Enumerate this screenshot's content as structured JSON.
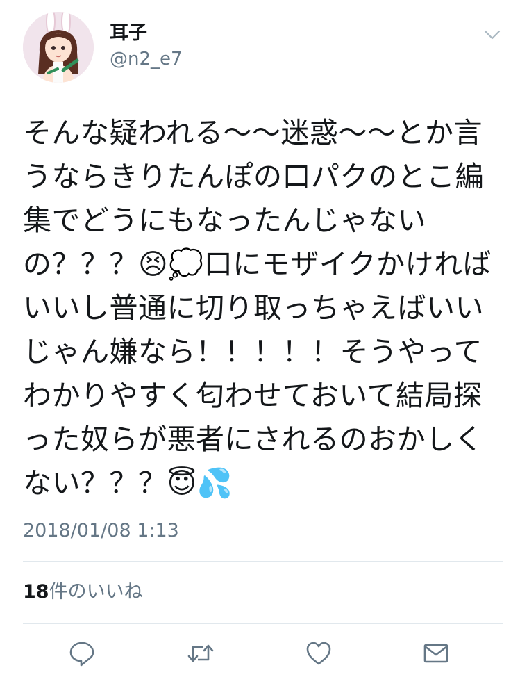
{
  "user": {
    "display_name": "耳子",
    "handle": "@n2_e7"
  },
  "tweet": {
    "text": "そんな疑われる〜〜迷惑〜〜とか言うならきりたんぽの口パクのとこ編集でどうにもなったんじゃないの？？？😣💭口にモザイクかければいいし普通に切り取っちゃえばいいじゃん嫌なら！！！！！そうやってわかりやすく匂わせておいて結局探った奴らが悪者にされるのおかしくない？？？😇💦",
    "timestamp": "2018/01/08 1:13"
  },
  "stats": {
    "likes_count": "18",
    "likes_label": "件のいいね"
  },
  "actions": {
    "reply_icon": "reply-icon",
    "retweet_icon": "retweet-icon",
    "like_icon": "heart-icon",
    "dm_icon": "envelope-icon"
  },
  "colors": {
    "text": "#14171a",
    "secondary": "#657786",
    "divider": "#e1e8ed",
    "icon": "#657786"
  }
}
